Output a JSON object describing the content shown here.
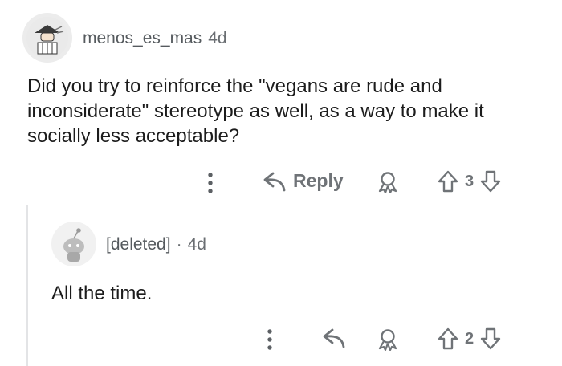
{
  "parent_comment": {
    "username": "menos_es_mas",
    "age": "4d",
    "body": "Did you try to reinforce the \"vegans are rude and inconsiderate\" stereotype as well, as a way to make it socially less acceptable?",
    "actions": {
      "more_icon": "more-vertical-icon",
      "reply_label": "Reply",
      "reply_icon": "reply-arrow-icon",
      "award_icon": "award-icon",
      "upvote_icon": "upvote-arrow-icon",
      "vote_count": "3",
      "downvote_icon": "downvote-arrow-icon"
    }
  },
  "reply_comment": {
    "username": "[deleted]",
    "separator": "·",
    "age": "4d",
    "body": "All the time.",
    "actions": {
      "more_icon": "more-vertical-icon",
      "reply_icon": "reply-arrow-icon",
      "award_icon": "award-icon",
      "upvote_icon": "upvote-arrow-icon",
      "vote_count": "2",
      "downvote_icon": "downvote-arrow-icon"
    }
  },
  "colors": {
    "text": "#1c1c1c",
    "meta": "#6f7377",
    "thread_line": "#e3e4e6"
  }
}
